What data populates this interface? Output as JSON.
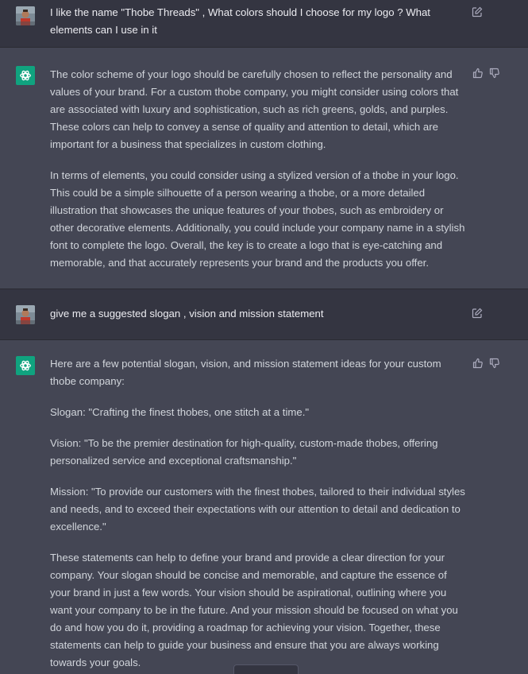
{
  "messages": [
    {
      "role": "user",
      "text": "I like the name \"Thobe Threads\" , What colors should I choose for my logo ? What elements can I use in it"
    },
    {
      "role": "assistant",
      "paragraphs": [
        "The color scheme of your logo should be carefully chosen to reflect the personality and values of your brand. For a custom thobe company, you might consider using colors that are associated with luxury and sophistication, such as rich greens, golds, and purples. These colors can help to convey a sense of quality and attention to detail, which are important for a business that specializes in custom clothing.",
        "In terms of elements, you could consider using a stylized version of a thobe in your logo. This could be a simple silhouette of a person wearing a thobe, or a more detailed illustration that showcases the unique features of your thobes, such as embroidery or other decorative elements. Additionally, you could include your company name in a stylish font to complete the logo. Overall, the key is to create a logo that is eye-catching and memorable, and that accurately represents your brand and the products you offer."
      ]
    },
    {
      "role": "user",
      "text": "give me a suggested slogan , vision and mission statement"
    },
    {
      "role": "assistant",
      "paragraphs": [
        "Here are a few potential slogan, vision, and mission statement ideas for your custom thobe company:",
        "Slogan: \"Crafting the finest thobes, one stitch at a time.\"",
        "Vision: \"To be the premier destination for high-quality, custom-made thobes, offering personalized service and exceptional craftsmanship.\"",
        "Mission: \"To provide our customers with the finest thobes, tailored to their individual styles and needs, and to exceed their expectations with our attention to detail and dedication to excellence.\"",
        "These statements can help to define your brand and provide a clear direction for your company. Your slogan should be concise and memorable, and capture the essence of your brand in just a few words. Your vision should be aspirational, outlining where you want your company to be in the future. And your mission should be focused on what you do and how you do it, providing a roadmap for achieving your vision. Together, these statements can help to guide your business and ensure that you are always working towards your goals."
      ]
    }
  ],
  "icons": {
    "edit": "edit-icon",
    "thumbs_up": "thumbs-up-icon",
    "thumbs_down": "thumbs-down-icon",
    "assistant_logo": "openai-logo-icon"
  },
  "colors": {
    "user_bg": "#343541",
    "assistant_bg": "#444654",
    "assistant_avatar": "#10a37f",
    "text": "#d1d5db"
  }
}
